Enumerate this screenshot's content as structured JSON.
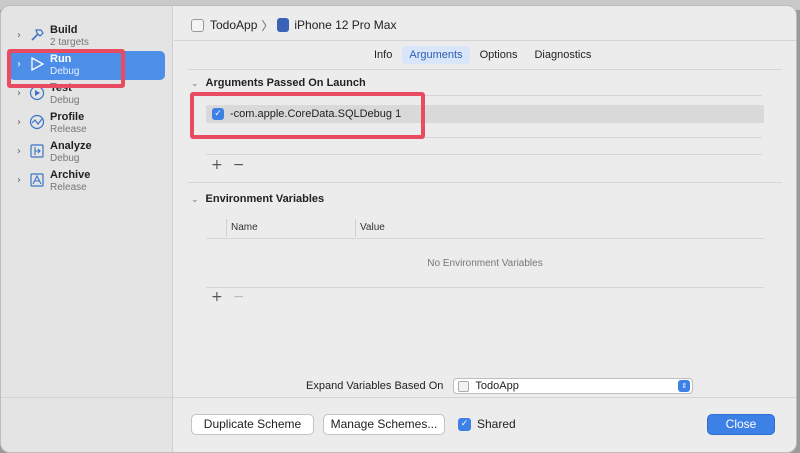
{
  "breadcrumb": {
    "project": "TodoApp",
    "separator": "〉",
    "device": "iPhone 12 Pro Max"
  },
  "sidebar": {
    "items": [
      {
        "title": "Build",
        "subtitle": "2 targets",
        "icon": "hammer-icon"
      },
      {
        "title": "Run",
        "subtitle": "Debug",
        "icon": "play-icon",
        "selected": true
      },
      {
        "title": "Test",
        "subtitle": "Debug",
        "icon": "test-icon"
      },
      {
        "title": "Profile",
        "subtitle": "Release",
        "icon": "profile-icon"
      },
      {
        "title": "Analyze",
        "subtitle": "Debug",
        "icon": "analyze-icon"
      },
      {
        "title": "Archive",
        "subtitle": "Release",
        "icon": "archive-icon"
      }
    ]
  },
  "tabs": [
    {
      "label": "Info"
    },
    {
      "label": "Arguments",
      "active": true
    },
    {
      "label": "Options"
    },
    {
      "label": "Diagnostics"
    }
  ],
  "arguments": {
    "section_title": "Arguments Passed On Launch",
    "rows": [
      {
        "checked": true,
        "value": "-com.apple.CoreData.SQLDebug 1"
      }
    ],
    "add": "+",
    "remove": "−"
  },
  "environment": {
    "section_title": "Environment Variables",
    "columns": {
      "name": "Name",
      "value": "Value"
    },
    "empty_text": "No Environment Variables",
    "add": "+",
    "remove": "−"
  },
  "expand": {
    "label": "Expand Variables Based On",
    "selected": "TodoApp"
  },
  "footer": {
    "duplicate": "Duplicate Scheme",
    "manage": "Manage Schemes...",
    "shared_label": "Shared",
    "shared_checked": true,
    "close": "Close"
  },
  "colors": {
    "accent": "#3d80e6",
    "highlight": "#e94c60",
    "selected_row": "#4c8ee8"
  }
}
